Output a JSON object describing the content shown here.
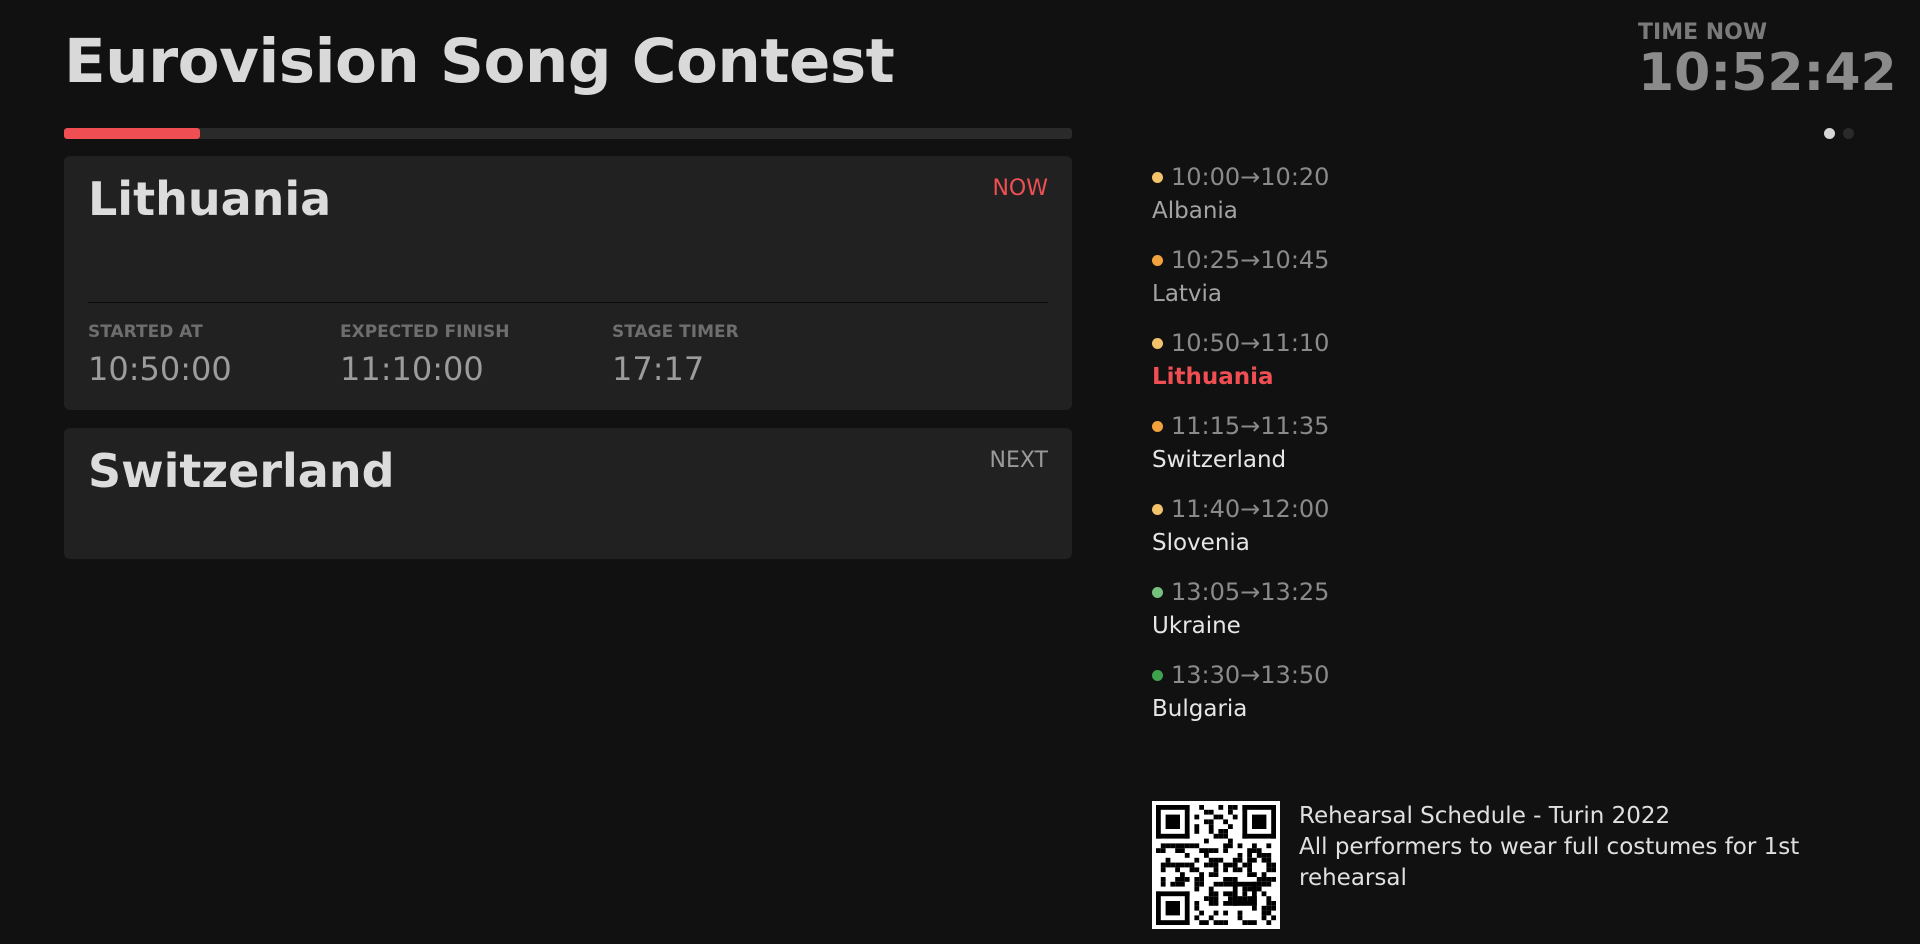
{
  "header": {
    "title": "Eurovision Song Contest"
  },
  "progress": {
    "fraction": 0.135,
    "color": "#ef4f52"
  },
  "clock": {
    "label": "TIME NOW",
    "value": "10:52:42"
  },
  "pagination": {
    "page_count": 2,
    "current_page": 1
  },
  "now_card": {
    "name": "Lithuania",
    "tag": "NOW",
    "metrics": [
      {
        "label": "STARTED AT",
        "value": "10:50:00"
      },
      {
        "label": "EXPECTED FINISH",
        "value": "11:10:00"
      },
      {
        "label": "STAGE TIMER",
        "value": "17:17"
      }
    ]
  },
  "next_card": {
    "name": "Switzerland",
    "tag": "NEXT"
  },
  "schedule": [
    {
      "time": "10:00→10:20",
      "name": "Albania",
      "dot_color": "#f2c36b",
      "state": "past"
    },
    {
      "time": "10:25→10:45",
      "name": "Latvia",
      "dot_color": "#f2a23c",
      "state": "past"
    },
    {
      "time": "10:50→11:10",
      "name": "Lithuania",
      "dot_color": "#f2c36b",
      "state": "current"
    },
    {
      "time": "11:15→11:35",
      "name": "Switzerland",
      "dot_color": "#f2a23c",
      "state": "upcoming"
    },
    {
      "time": "11:40→12:00",
      "name": "Slovenia",
      "dot_color": "#f2c36b",
      "state": "upcoming"
    },
    {
      "time": "13:05→13:25",
      "name": "Ukraine",
      "dot_color": "#77c17f",
      "state": "upcoming"
    },
    {
      "time": "13:30→13:50",
      "name": "Bulgaria",
      "dot_color": "#3fa34d",
      "state": "upcoming"
    }
  ],
  "info": {
    "line1": "Rehearsal Schedule - Turin 2022",
    "line2": "All performers to wear full costumes for 1st rehearsal"
  },
  "colors": {
    "background": "#111111",
    "card": "#212121",
    "accent": "#ef4f52"
  }
}
